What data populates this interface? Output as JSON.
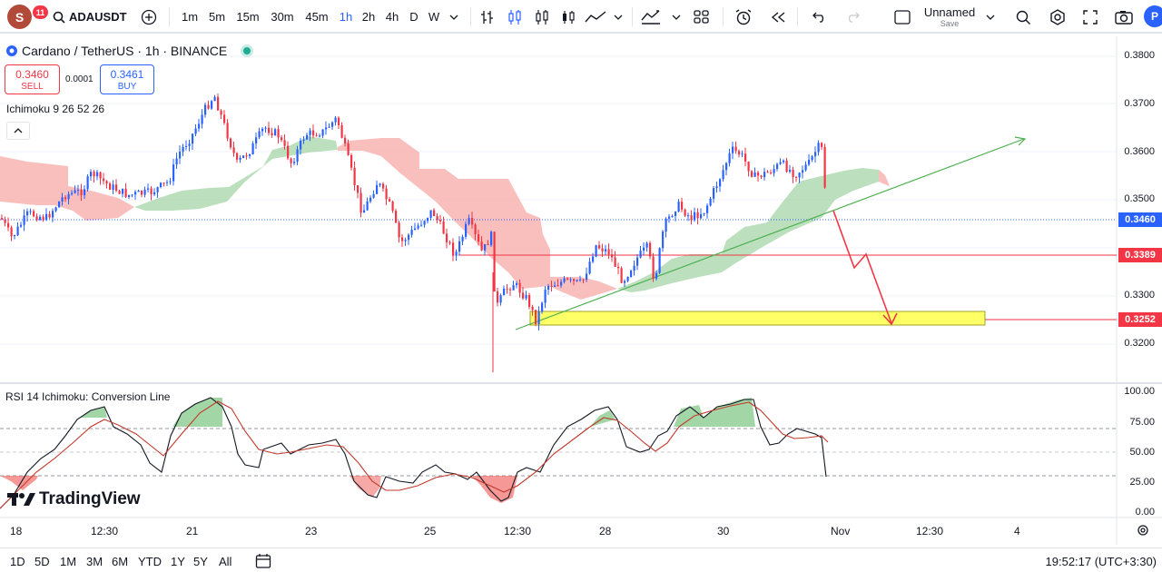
{
  "topbar": {
    "avatar_letter": "S",
    "notif_count": "11",
    "symbol": "ADAUSDT",
    "timeframes": [
      "1m",
      "5m",
      "15m",
      "30m",
      "45m",
      "1h",
      "2h",
      "4h",
      "D",
      "W"
    ],
    "active_timeframe": "1h",
    "layout_name": "Unnamed",
    "layout_status": "Save"
  },
  "legend": {
    "title": "Cardano / TetherUS · 1h · BINANCE",
    "sell_price": "0.3460",
    "sell_label": "SELL",
    "spread": "0.0001",
    "buy_price": "0.3461",
    "buy_label": "BUY",
    "indicator": "Ichimoku 9 26 52 26",
    "rsi_label": "RSI 14 Ichimoku: Conversion Line",
    "watermark": "TradingView"
  },
  "price_axis": {
    "ticks": [
      "0.3800",
      "0.3700",
      "0.3600",
      "0.3500",
      "0.3300",
      "0.3200"
    ],
    "current_price": "0.3460",
    "level_1": "0.3389",
    "level_2": "0.3252"
  },
  "rsi_axis": {
    "ticks": [
      "100.00",
      "75.00",
      "50.00",
      "25.00",
      "0.00"
    ]
  },
  "time_axis": {
    "labels": [
      "18",
      "12:30",
      "21",
      "23",
      "25",
      "12:30",
      "28",
      "30",
      "Nov",
      "12:30",
      "4"
    ]
  },
  "bottombar": {
    "ranges": [
      "1D",
      "5D",
      "1M",
      "3M",
      "6M",
      "YTD",
      "1Y",
      "5Y",
      "All"
    ],
    "clock": "19:52:17 (UTC+3:30)"
  },
  "colors": {
    "up": "#2962ff",
    "down": "#f23645",
    "cloud_bull": "#a5d6a7",
    "cloud_bear": "#f7a9a7",
    "zone": "#ffff66"
  }
}
